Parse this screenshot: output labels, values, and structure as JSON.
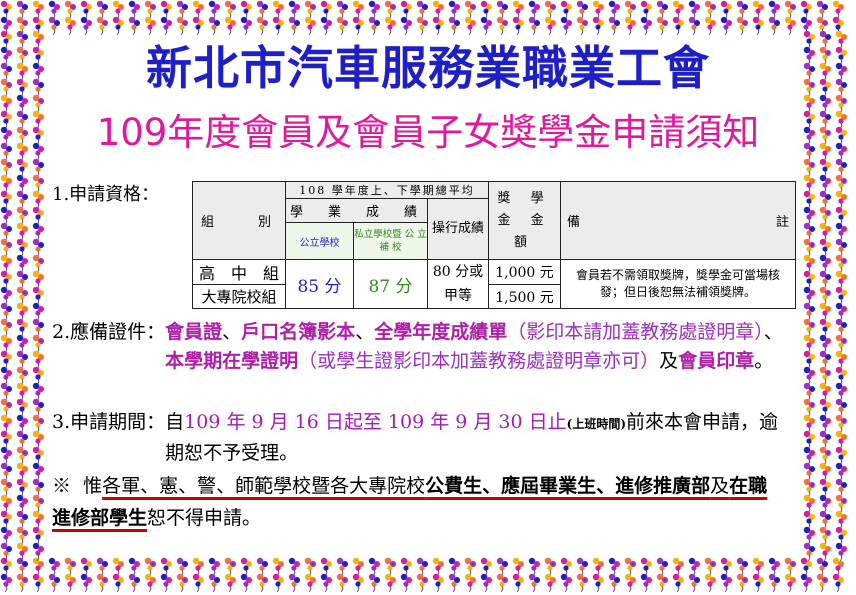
{
  "colors": {
    "title": "#1f1fc8",
    "subtitle": "#e0189c",
    "emphasis": "#b01ea8",
    "underline": "#d00000"
  },
  "title": "新北市汽車服務業職業工會",
  "subtitle": "109年度會員及會員子女獎學金申請須知",
  "section1": {
    "label": "1.申請資格：",
    "table": {
      "header_top": "108 學年度上、下學期總平均",
      "col_group": "組　　別",
      "col_grades": "學　業　成　績",
      "col_public": "公立學校",
      "col_private": "私立學校暨 公 立 補 校",
      "col_conduct": "操行成績",
      "col_amount": "獎 學 金 金　額",
      "col_remark_left": "備",
      "col_remark_right": "註",
      "rows": [
        {
          "group": "高　中　組",
          "amount": "1,000 元"
        },
        {
          "group": "大專院校組",
          "amount": "1,500 元"
        }
      ],
      "public_score": "85 分",
      "private_score": "87 分",
      "conduct_line1": "80 分或",
      "conduct_line2": "甲等",
      "note": "會員若不需領取獎牌，獎學金可當場核發；但日後恕無法補領獎牌。"
    }
  },
  "section2": {
    "label": "2.應備證件：",
    "item1": "會員證",
    "sep1": "、",
    "item2": "戶口名簿影本",
    "sep2": "、",
    "item3": "全學年度成績單",
    "note1": "（影印本請加蓋教務處證明章）",
    "sep3": "、",
    "item4": "本學期在學證明",
    "note2": "（或學生證影印本加蓋教務處證明章亦可）",
    "and": "及",
    "item5": "會員印章",
    "end": "。"
  },
  "section3": {
    "label": "3.申請期間：",
    "from": "自",
    "period": "109 年 9 月 16 日起至 109 年 9 月 30 日止",
    "hours": "(上班時間)",
    "rest": "前來本會申請，逾期恕不予受理。"
  },
  "section4": {
    "mark": "※",
    "t1": "惟",
    "t2": "各軍、憲、警、師範學校暨各大專院校",
    "t3": "公費生、應屆畢業生、進修推廣部",
    "t4": "及",
    "t5": "在職進修部學生",
    "t6": "恕不得申請。"
  }
}
